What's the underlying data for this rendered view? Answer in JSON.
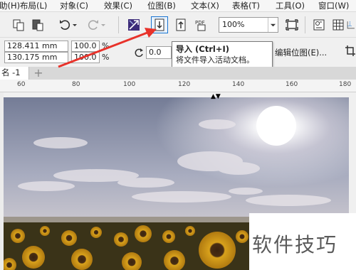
{
  "menu": {
    "items": [
      {
        "label": "助(H)",
        "partial": true
      },
      {
        "label": "布局(L)"
      },
      {
        "label": "对象(C)"
      },
      {
        "label": "效果(C)"
      },
      {
        "label": "位图(B)"
      },
      {
        "label": "文本(X)"
      },
      {
        "label": "表格(T)"
      },
      {
        "label": "工具(O)"
      },
      {
        "label": "窗口(W)"
      }
    ]
  },
  "toolbar": {
    "zoom": "100%",
    "pdf_label": "PDF"
  },
  "property_bar": {
    "width_value": "128.411 mm",
    "height_value": "130.175 mm",
    "scale_x": "100.0",
    "scale_y": "100.0",
    "scale_unit": "%",
    "rotation": "0.0",
    "edit_bitmap_label": "编辑位图(E)..."
  },
  "tooltip": {
    "title": "导入 (Ctrl+I)",
    "description": "将文件导入活动文档。"
  },
  "document_tab": {
    "label": "名 -1",
    "add_label": "+"
  },
  "ruler": {
    "labels": [
      "60",
      "80",
      "100",
      "120",
      "140",
      "160",
      "180"
    ]
  },
  "canvas": {
    "watermark": "软件技巧"
  },
  "colors": {
    "arrow": "#e8322a",
    "highlight_border": "#1a74d0",
    "sky_top": "#8d96ad",
    "sky_bottom": "#c9c6cf",
    "sun": "#ffffff",
    "sunflower": "#c8911a"
  },
  "icons": [
    "copy-icon",
    "paste-icon",
    "undo-icon",
    "redo-icon",
    "publish-icon",
    "import-icon",
    "export-icon",
    "pdf-icon",
    "fullscreen-icon",
    "options-icon",
    "grid-icon",
    "guidelines-icon",
    "rotate-icon",
    "crop-icon"
  ]
}
